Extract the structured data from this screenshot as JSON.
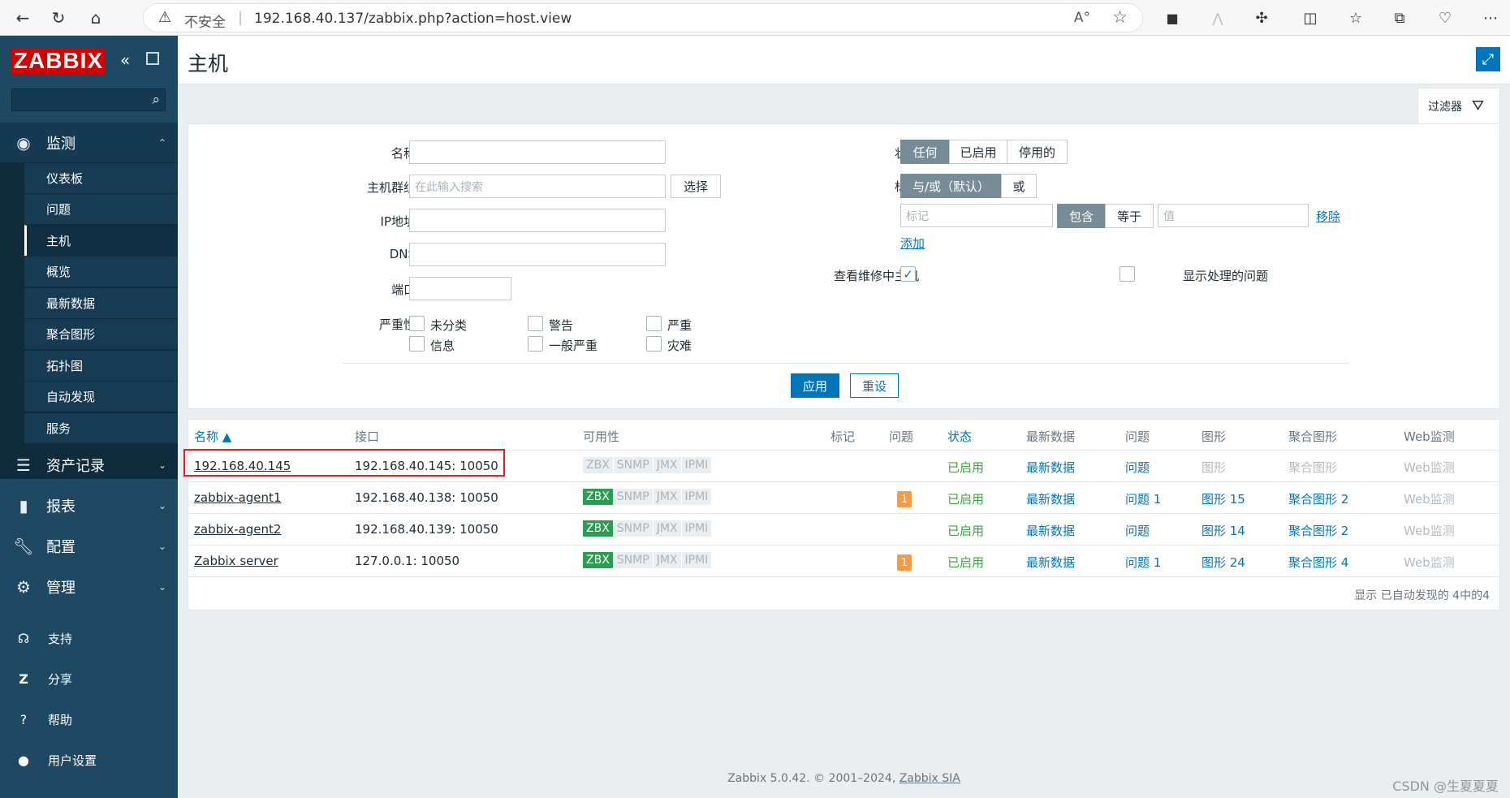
{
  "browser": {
    "security_label": "不安全",
    "url": "192.168.40.137/zabbix.php?action=host.view"
  },
  "sidebar": {
    "logo": "ZABBIX",
    "sections": [
      {
        "label": "监测",
        "icon": "eye-icon"
      },
      {
        "label": "资产记录",
        "icon": "list-icon"
      },
      {
        "label": "报表",
        "icon": "bar-chart-icon"
      },
      {
        "label": "配置",
        "icon": "wrench-icon"
      },
      {
        "label": "管理",
        "icon": "gear-icon"
      }
    ],
    "monitoring_items": [
      "仪表板",
      "问题",
      "主机",
      "概览",
      "最新数据",
      "聚合图形",
      "拓扑图",
      "自动发现",
      "服务"
    ],
    "utilities": [
      {
        "label": "支持",
        "icon": "headset-icon"
      },
      {
        "label": "分享",
        "icon": "share-icon"
      },
      {
        "label": "帮助",
        "icon": "help-icon"
      },
      {
        "label": "用户设置",
        "icon": "user-icon"
      }
    ]
  },
  "page": {
    "title": "主机",
    "filter_tab": "过滤器"
  },
  "filter": {
    "name_label": "名称",
    "name_value": "",
    "hostgroup_label": "主机群组",
    "hostgroup_placeholder": "在此输入搜索",
    "select_button": "选择",
    "ip_label": "IP地址",
    "dns_label": "DNS",
    "port_label": "端口",
    "severity_label": "严重性",
    "severities": [
      "未分类",
      "警告",
      "严重",
      "信息",
      "一般严重",
      "灾难"
    ],
    "status_label": "状态",
    "status_options": [
      "任何",
      "已启用",
      "停用的"
    ],
    "status_selected": "任何",
    "tags_label": "标记",
    "tag_mode_options": [
      "与/或（默认）",
      "或"
    ],
    "tag_placeholder": "标记",
    "tag_operators": [
      "包含",
      "等于"
    ],
    "value_placeholder": "值",
    "remove_link": "移除",
    "add_link": "添加",
    "maintenance_label": "查看维修中主机",
    "maintenance_checked": true,
    "suppressed_label": "显示处理的问题",
    "suppressed_checked": false,
    "apply_button": "应用",
    "reset_button": "重设"
  },
  "table": {
    "columns": [
      "名称 ▲",
      "接口",
      "可用性",
      "标记",
      "问题",
      "状态",
      "最新数据",
      "问题",
      "图形",
      "聚合图形",
      "Web监测"
    ],
    "rows": [
      {
        "name": "192.168.40.145",
        "interface": "192.168.40.145: 10050",
        "zbx_available": false,
        "problems": "",
        "status": "已启用",
        "latest": "最新数据",
        "problems_link": "问题",
        "graphs": "图形",
        "screens": "聚合图形",
        "web": "Web监测"
      },
      {
        "name": "zabbix-agent1",
        "interface": "192.168.40.138: 10050",
        "zbx_available": true,
        "problems": "1",
        "status": "已启用",
        "latest": "最新数据",
        "problems_link": "问题 1",
        "graphs": "图形 15",
        "screens": "聚合图形 2",
        "web": "Web监测"
      },
      {
        "name": "zabbix-agent2",
        "interface": "192.168.40.139: 10050",
        "zbx_available": true,
        "problems": "",
        "status": "已启用",
        "latest": "最新数据",
        "problems_link": "问题",
        "graphs": "图形 14",
        "screens": "聚合图形 2",
        "web": "Web监测"
      },
      {
        "name": "Zabbix server",
        "interface": "127.0.0.1: 10050",
        "zbx_available": true,
        "problems": "1",
        "status": "已启用",
        "latest": "最新数据",
        "problems_link": "问题 1",
        "graphs": "图形 24",
        "screens": "聚合图形 4",
        "web": "Web监测"
      }
    ],
    "availability_labels": [
      "ZBX",
      "SNMP",
      "JMX",
      "IPMI"
    ],
    "summary": "显示 已自动发现的 4中的4"
  },
  "footer": {
    "text": "Zabbix 5.0.42. © 2001–2024, ",
    "company": "Zabbix SIA"
  },
  "watermark": "CSDN @生夏夏夏",
  "colors": {
    "sidebar": "#1f4863",
    "accent": "#0275b8",
    "logo_red": "#d40000",
    "enabled_green": "#429e47",
    "problem_orange": "#f79a42"
  }
}
